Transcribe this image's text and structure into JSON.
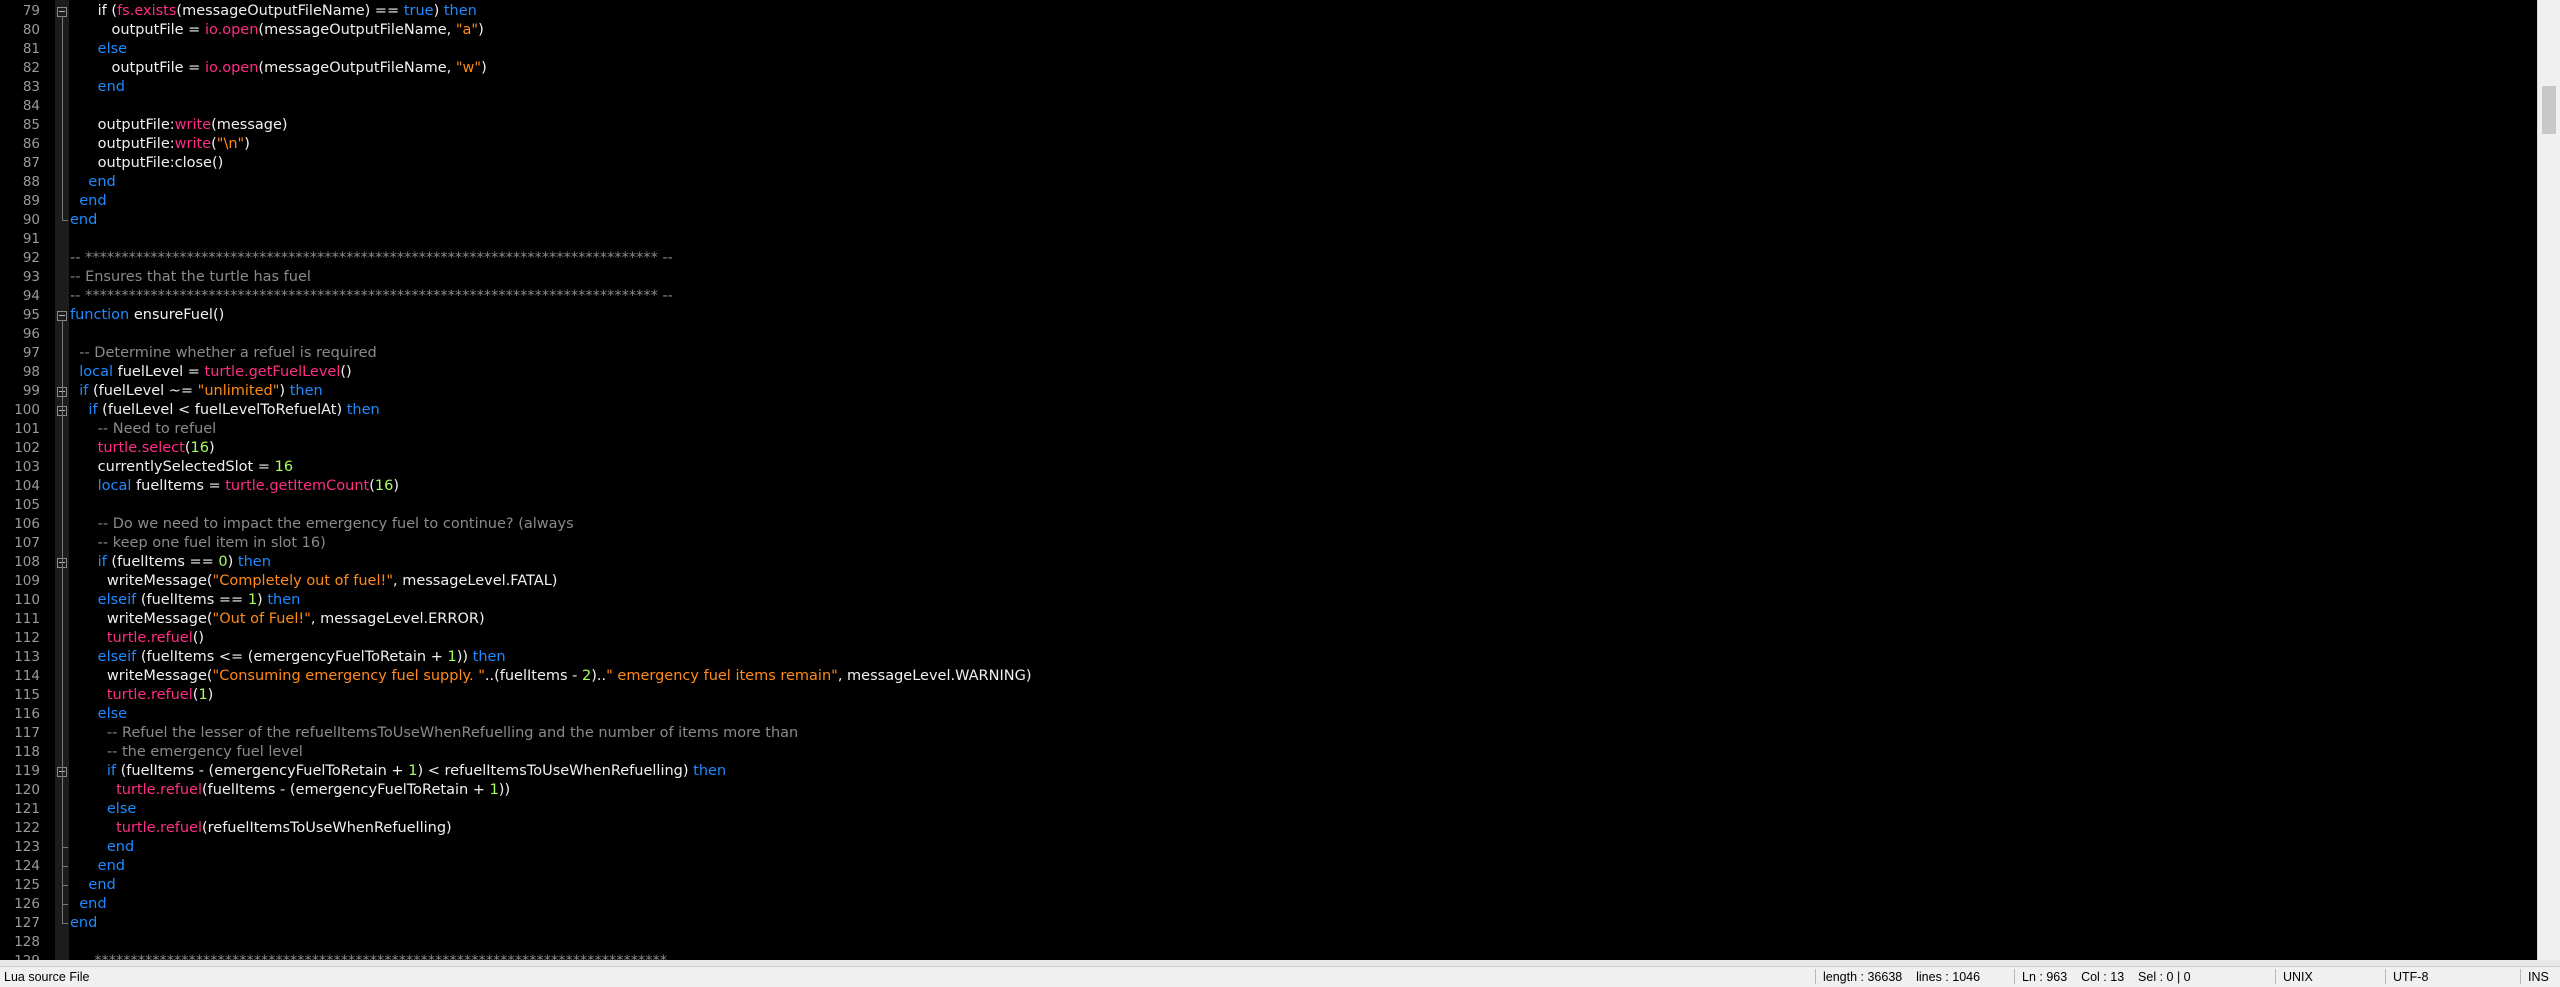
{
  "editor": {
    "lines": [
      {
        "n": "79",
        "fold": true,
        "t": [
          [
            "tx",
            "      if ("
          ],
          [
            "fn",
            "fs.exists"
          ],
          [
            "tx",
            "(messageOutputFileName) == "
          ],
          [
            "kw",
            "true"
          ],
          [
            "tx",
            ") "
          ],
          [
            "kw",
            "then"
          ]
        ]
      },
      {
        "n": "80",
        "t": [
          [
            "tx",
            "         outputFile = "
          ],
          [
            "fn",
            "io.open"
          ],
          [
            "tx",
            "(messageOutputFileName, "
          ],
          [
            "str",
            "\"a\""
          ],
          [
            "tx",
            ")"
          ]
        ]
      },
      {
        "n": "81",
        "t": [
          [
            "kw",
            "      else"
          ]
        ]
      },
      {
        "n": "82",
        "t": [
          [
            "tx",
            "         outputFile = "
          ],
          [
            "fn",
            "io.open"
          ],
          [
            "tx",
            "(messageOutputFileName, "
          ],
          [
            "str",
            "\"w\""
          ],
          [
            "tx",
            ")"
          ]
        ]
      },
      {
        "n": "83",
        "t": [
          [
            "kw",
            "      end"
          ]
        ]
      },
      {
        "n": "84",
        "t": []
      },
      {
        "n": "85",
        "t": [
          [
            "tx",
            "      outputFile:"
          ],
          [
            "fn",
            "write"
          ],
          [
            "tx",
            "(message)"
          ]
        ]
      },
      {
        "n": "86",
        "t": [
          [
            "tx",
            "      outputFile:"
          ],
          [
            "fn",
            "write"
          ],
          [
            "tx",
            "("
          ],
          [
            "str",
            "\"\\n\""
          ],
          [
            "tx",
            ")"
          ]
        ]
      },
      {
        "n": "87",
        "t": [
          [
            "tx",
            "      outputFile:close()"
          ]
        ]
      },
      {
        "n": "88",
        "t": [
          [
            "kw",
            "    end"
          ]
        ]
      },
      {
        "n": "89",
        "t": [
          [
            "kw",
            "  end"
          ]
        ]
      },
      {
        "n": "90",
        "t": [
          [
            "kw",
            "end"
          ]
        ]
      },
      {
        "n": "91",
        "t": []
      },
      {
        "n": "92",
        "t": [
          [
            "cm",
            "-- ******************************************************************************* --"
          ]
        ]
      },
      {
        "n": "93",
        "t": [
          [
            "cm",
            "-- Ensures that the turtle has fuel"
          ]
        ]
      },
      {
        "n": "94",
        "t": [
          [
            "cm",
            "-- ******************************************************************************* --"
          ]
        ]
      },
      {
        "n": "95",
        "fold": true,
        "t": [
          [
            "kw",
            "function"
          ],
          [
            "tx",
            " ensureFuel()"
          ]
        ]
      },
      {
        "n": "96",
        "t": []
      },
      {
        "n": "97",
        "t": [
          [
            "cm",
            "  -- Determine whether a refuel is required"
          ]
        ]
      },
      {
        "n": "98",
        "t": [
          [
            "kw",
            "  local"
          ],
          [
            "tx",
            " fuelLevel = "
          ],
          [
            "fn",
            "turtle.getFuelLevel"
          ],
          [
            "tx",
            "()"
          ]
        ]
      },
      {
        "n": "99",
        "fold": true,
        "t": [
          [
            "kw",
            "  if"
          ],
          [
            "tx",
            " (fuelLevel ~= "
          ],
          [
            "str",
            "\"unlimited\""
          ],
          [
            "tx",
            ") "
          ],
          [
            "kw",
            "then"
          ]
        ]
      },
      {
        "n": "100",
        "fold": true,
        "t": [
          [
            "kw",
            "    if"
          ],
          [
            "tx",
            " (fuelLevel < fuelLevelToRefuelAt) "
          ],
          [
            "kw",
            "then"
          ]
        ]
      },
      {
        "n": "101",
        "t": [
          [
            "cm",
            "      -- Need to refuel"
          ]
        ]
      },
      {
        "n": "102",
        "t": [
          [
            "fn",
            "      turtle.select"
          ],
          [
            "tx",
            "("
          ],
          [
            "num",
            "16"
          ],
          [
            "tx",
            ")"
          ]
        ]
      },
      {
        "n": "103",
        "t": [
          [
            "tx",
            "      currentlySelectedSlot = "
          ],
          [
            "num",
            "16"
          ]
        ]
      },
      {
        "n": "104",
        "t": [
          [
            "kw",
            "      local"
          ],
          [
            "tx",
            " fuelItems = "
          ],
          [
            "fn",
            "turtle.getItemCount"
          ],
          [
            "tx",
            "("
          ],
          [
            "num",
            "16"
          ],
          [
            "tx",
            ")"
          ]
        ]
      },
      {
        "n": "105",
        "t": []
      },
      {
        "n": "106",
        "t": [
          [
            "cm",
            "      -- Do we need to impact the emergency fuel to continue? (always"
          ]
        ]
      },
      {
        "n": "107",
        "t": [
          [
            "cm",
            "      -- keep one fuel item in slot 16)"
          ]
        ]
      },
      {
        "n": "108",
        "fold": true,
        "t": [
          [
            "kw",
            "      if"
          ],
          [
            "tx",
            " (fuelItems == "
          ],
          [
            "num",
            "0"
          ],
          [
            "tx",
            ") "
          ],
          [
            "kw",
            "then"
          ]
        ]
      },
      {
        "n": "109",
        "t": [
          [
            "tx",
            "        writeMessage("
          ],
          [
            "str",
            "\"Completely out of fuel!\""
          ],
          [
            "tx",
            ", messageLevel.FATAL)"
          ]
        ]
      },
      {
        "n": "110",
        "t": [
          [
            "kw",
            "      elseif"
          ],
          [
            "tx",
            " (fuelItems == "
          ],
          [
            "num",
            "1"
          ],
          [
            "tx",
            ") "
          ],
          [
            "kw",
            "then"
          ]
        ]
      },
      {
        "n": "111",
        "t": [
          [
            "tx",
            "        writeMessage("
          ],
          [
            "str",
            "\"Out of Fuel!\""
          ],
          [
            "tx",
            ", messageLevel.ERROR)"
          ]
        ]
      },
      {
        "n": "112",
        "t": [
          [
            "fn",
            "        turtle.refuel"
          ],
          [
            "tx",
            "()"
          ]
        ]
      },
      {
        "n": "113",
        "t": [
          [
            "kw",
            "      elseif"
          ],
          [
            "tx",
            " (fuelItems <= (emergencyFuelToRetain + "
          ],
          [
            "num",
            "1"
          ],
          [
            "tx",
            ")) "
          ],
          [
            "kw",
            "then"
          ]
        ]
      },
      {
        "n": "114",
        "t": [
          [
            "tx",
            "        writeMessage("
          ],
          [
            "str",
            "\"Consuming emergency fuel supply. \""
          ],
          [
            "tx",
            "..(fuelItems - "
          ],
          [
            "num",
            "2"
          ],
          [
            "tx",
            ").."
          ],
          [
            "str",
            "\" emergency fuel items remain\""
          ],
          [
            "tx",
            ", messageLevel.WARNING)"
          ]
        ]
      },
      {
        "n": "115",
        "t": [
          [
            "fn",
            "        turtle.refuel"
          ],
          [
            "tx",
            "("
          ],
          [
            "num",
            "1"
          ],
          [
            "tx",
            ")"
          ]
        ]
      },
      {
        "n": "116",
        "t": [
          [
            "kw",
            "      else"
          ]
        ]
      },
      {
        "n": "117",
        "t": [
          [
            "cm",
            "        -- Refuel the lesser of the refuelItemsToUseWhenRefuelling and the number of items more than"
          ]
        ]
      },
      {
        "n": "118",
        "t": [
          [
            "cm",
            "        -- the emergency fuel level"
          ]
        ]
      },
      {
        "n": "119",
        "fold": true,
        "t": [
          [
            "kw",
            "        if"
          ],
          [
            "tx",
            " (fuelItems - (emergencyFuelToRetain + "
          ],
          [
            "num",
            "1"
          ],
          [
            "tx",
            ") < refuelItemsToUseWhenRefuelling) "
          ],
          [
            "kw",
            "then"
          ]
        ]
      },
      {
        "n": "120",
        "t": [
          [
            "fn",
            "          turtle.refuel"
          ],
          [
            "tx",
            "(fuelItems - (emergencyFuelToRetain + "
          ],
          [
            "num",
            "1"
          ],
          [
            "tx",
            "))"
          ]
        ]
      },
      {
        "n": "121",
        "t": [
          [
            "kw",
            "        else"
          ]
        ]
      },
      {
        "n": "122",
        "t": [
          [
            "fn",
            "          turtle.refuel"
          ],
          [
            "tx",
            "(refuelItemsToUseWhenRefuelling)"
          ]
        ]
      },
      {
        "n": "123",
        "t": [
          [
            "kw",
            "        end"
          ]
        ]
      },
      {
        "n": "124",
        "t": [
          [
            "kw",
            "      end"
          ]
        ]
      },
      {
        "n": "125",
        "t": [
          [
            "kw",
            "    end"
          ]
        ]
      },
      {
        "n": "126",
        "t": [
          [
            "kw",
            "  end"
          ]
        ]
      },
      {
        "n": "127",
        "t": [
          [
            "kw",
            "end"
          ]
        ]
      },
      {
        "n": "128",
        "t": []
      },
      {
        "n": "129",
        "t": [
          [
            "cm",
            "  -- *******************************************************************************"
          ]
        ]
      }
    ]
  },
  "statusbar": {
    "file_type": "Lua source File",
    "length_lines": "length : 36638    lines : 1046",
    "position": "Ln : 963    Col : 13    Sel : 0 | 0",
    "eol": "UNIX",
    "encoding": "UTF-8",
    "mode": "INS"
  }
}
